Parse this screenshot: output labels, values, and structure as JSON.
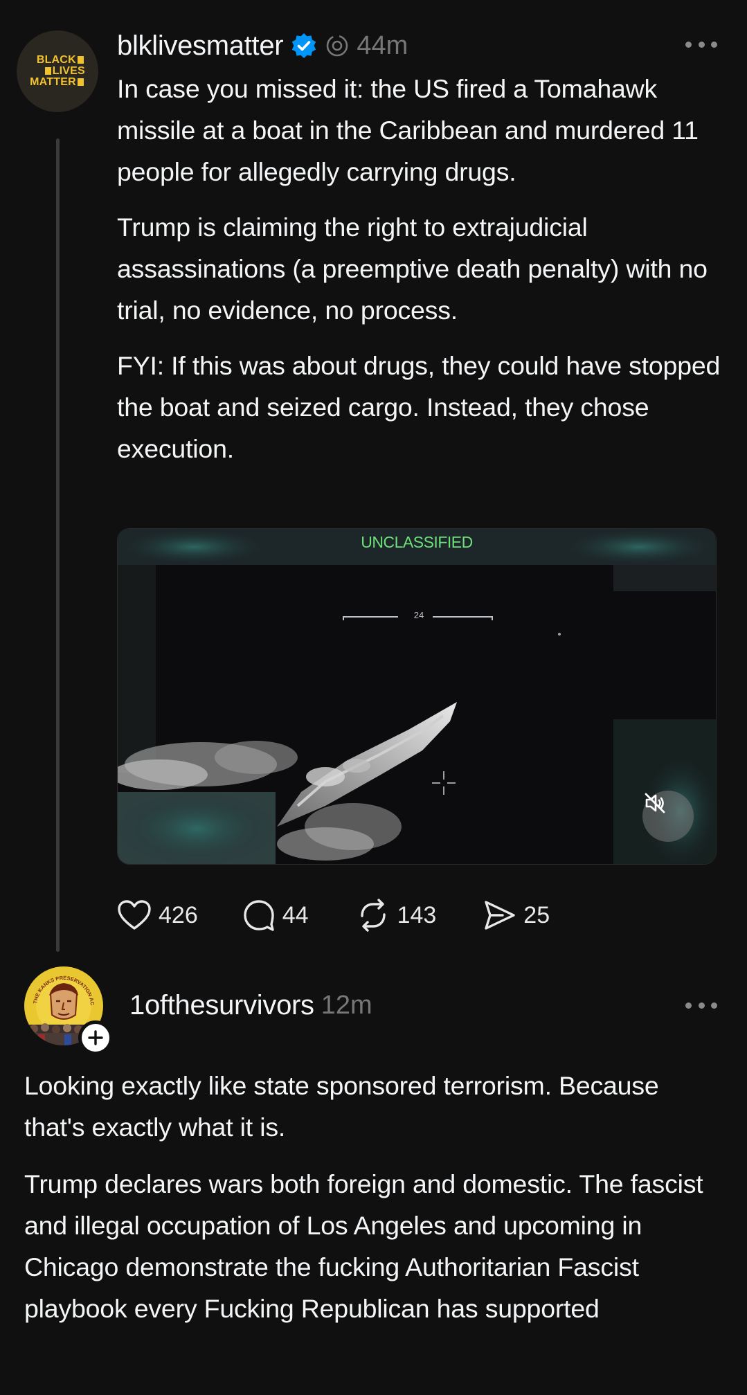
{
  "post": {
    "avatar_logo_lines": [
      "BLACK",
      "LIVES",
      "MATTER"
    ],
    "username": "blklivesmatter",
    "verified": true,
    "time": "44m",
    "paragraphs": [
      "In case you missed it: the US fired a Tomahawk missile at a boat in the Caribbean and murdered 11 people for allegedly carrying drugs.",
      "Trump is claiming the right to extrajudicial assassinations (a preemptive death penalty) with no trial, no evidence, no process.",
      "FYI: If this was about drugs, they could have stopped the boat and seized cargo. Instead, they chose execution."
    ],
    "video": {
      "overlay_label": "UNCLASSIFIED",
      "reticle_number": "24",
      "muted": true
    },
    "actions": {
      "likes": "426",
      "comments": "44",
      "reposts": "143",
      "shares": "25"
    }
  },
  "reply": {
    "avatar_caption": "THE KANKS PRESERVATION ACT",
    "username": "1ofthesurvivors",
    "time": "12m",
    "paragraphs": [
      "Looking exactly like state sponsored terrorism. Because that's exactly what it is.",
      "Trump declares wars both foreign and domestic. The fascist and illegal occupation of Los Angeles and upcoming in Chicago demonstrate the fucking Authoritarian Fascist playbook every Fucking Republican has supported"
    ]
  },
  "colors": {
    "background": "#101010",
    "text": "#f3f5f7",
    "muted": "#777777",
    "verified": "#0095f6",
    "blm_yellow": "#f2c12e",
    "overlay_green": "#6ee07a"
  }
}
